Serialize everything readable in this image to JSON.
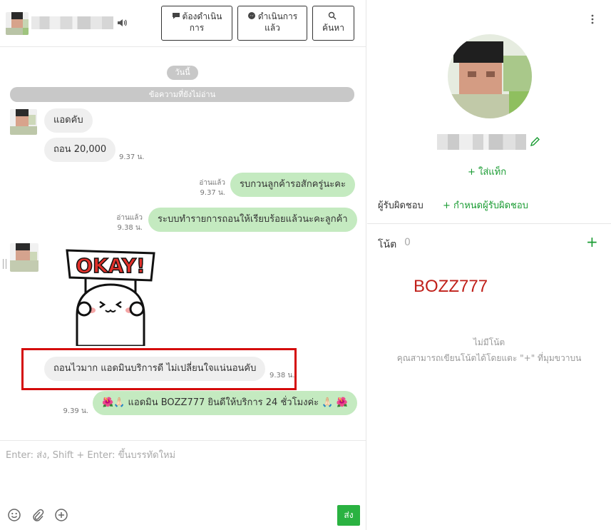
{
  "header": {
    "btn_todo_line1": "ต้องดำเนิน",
    "btn_todo_line2": "การ",
    "btn_done_line1": "ดำเนินการ",
    "btn_done_line2": "แล้ว",
    "btn_search": "ค้นหา"
  },
  "chat": {
    "date_label": "วันนี้",
    "unread_label": "ข้อความที่ยังไม่อ่าน",
    "messages": [
      {
        "text": "แอดคับ"
      },
      {
        "text": "ถอน 20,000",
        "time": "9.37 น."
      },
      {
        "text": "รบกวนลูกค้ารอสักครู่นะคะ",
        "read": "อ่านแล้ว",
        "time": "9.37 น."
      },
      {
        "text": "ระบบทำรายการถอนให้เรียบร้อยแล้วนะคะลูกค้า",
        "read": "อ่านแล้ว",
        "time": "9.38 น."
      },
      {
        "text": "ถอนไวมาก แอดมินบริการดี ไม่เปลี่ยนใจแน่นอนคับ",
        "time": "9.38 น."
      },
      {
        "text": "🌺🙏🏻  แอดมิน BOZZ777 ยินดีให้บริการ 24 ชั่วโมงค่ะ 🙏🏻 🌺",
        "time": "9.39 น."
      }
    ],
    "sticker_text": "OKAY!"
  },
  "composer": {
    "placeholder": "Enter: ส่ง, Shift + Enter: ขึ้นบรรทัดใหม่",
    "send_label": "ส่ง"
  },
  "profile": {
    "add_tag": "+ ใส่แท็ก",
    "owner_label": "ผู้รับผิดชอบ",
    "owner_add": "+ กำหนดผู้รับผิดชอบ",
    "notes_label": "โน้ต",
    "notes_count": "0",
    "notes_add": "+",
    "overlay_brand": "BOZZ777",
    "empty_title": "ไม่มีโน้ต",
    "empty_desc": "คุณสามารถเขียนโน้ตได้โดยแตะ \"+\" ที่มุมขวาบน"
  },
  "colors": {
    "accent_green": "#1a9c33",
    "send_green": "#2ab241",
    "outgoing_bubble": "#c4eac0",
    "incoming_bubble": "#efefef",
    "highlight_red": "#d40b0b",
    "brand_red": "#c0201a"
  },
  "icons": [
    "speaker-icon",
    "speech-bubble-icon",
    "messenger-icon",
    "search-icon",
    "more-vertical-icon",
    "pencil-icon",
    "emoji-icon",
    "paperclip-icon",
    "add-circle-icon"
  ]
}
